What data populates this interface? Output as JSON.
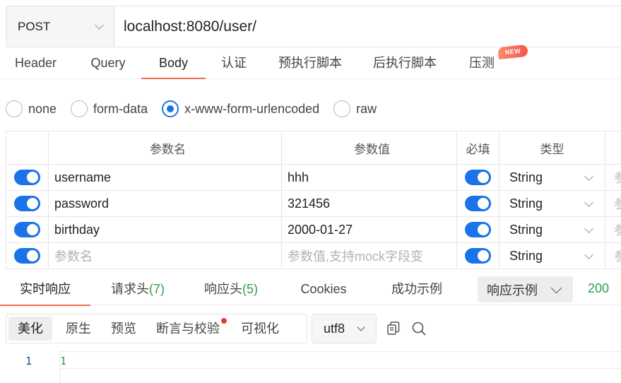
{
  "request": {
    "method": "POST",
    "url": "localhost:8080/user/"
  },
  "request_tabs": [
    {
      "label": "Header"
    },
    {
      "label": "Query"
    },
    {
      "label": "Body"
    },
    {
      "label": "认证"
    },
    {
      "label": "预执行脚本"
    },
    {
      "label": "后执行脚本"
    },
    {
      "label": "压测"
    }
  ],
  "new_badge": "NEW",
  "body_types": [
    {
      "label": "none",
      "selected": false
    },
    {
      "label": "form-data",
      "selected": false
    },
    {
      "label": "x-www-form-urlencoded",
      "selected": true
    },
    {
      "label": "raw",
      "selected": false
    }
  ],
  "params": {
    "headers": {
      "name": "参数名",
      "value": "参数值",
      "required": "必填",
      "type": "类型",
      "desc": "参"
    },
    "rows": [
      {
        "enabled": true,
        "name": "username",
        "value": "hhh",
        "required": true,
        "type": "String",
        "desc": "参"
      },
      {
        "enabled": true,
        "name": "password",
        "value": "321456",
        "required": true,
        "type": "String",
        "desc": "参"
      },
      {
        "enabled": true,
        "name": "birthday",
        "value": "2000-01-27",
        "required": true,
        "type": "String",
        "desc": "参"
      }
    ],
    "new_row": {
      "enabled": true,
      "name_placeholder": "参数名",
      "value_placeholder": "参数值,支持mock字段变",
      "required": true,
      "type": "String",
      "desc": "参"
    }
  },
  "response_tabs": [
    {
      "label": "实时响应",
      "count": ""
    },
    {
      "label": "请求头",
      "count": "(7)"
    },
    {
      "label": "响应头",
      "count": "(5)"
    },
    {
      "label": "Cookies",
      "count": ""
    },
    {
      "label": "成功示例",
      "count": ""
    }
  ],
  "response_example_select": "响应示例",
  "status_code": "200",
  "view_modes": [
    {
      "label": "美化"
    },
    {
      "label": "原生"
    },
    {
      "label": "预览"
    },
    {
      "label": "断言与校验"
    },
    {
      "label": "可视化"
    }
  ],
  "encoding": "utf8",
  "editor": {
    "line_number": "1",
    "content": "1"
  },
  "colors": {
    "accent": "#ef6b4e",
    "toggle_blue": "#1a73e8",
    "status_green": "#2e9e4d",
    "badge_red": "#e83a2f"
  }
}
